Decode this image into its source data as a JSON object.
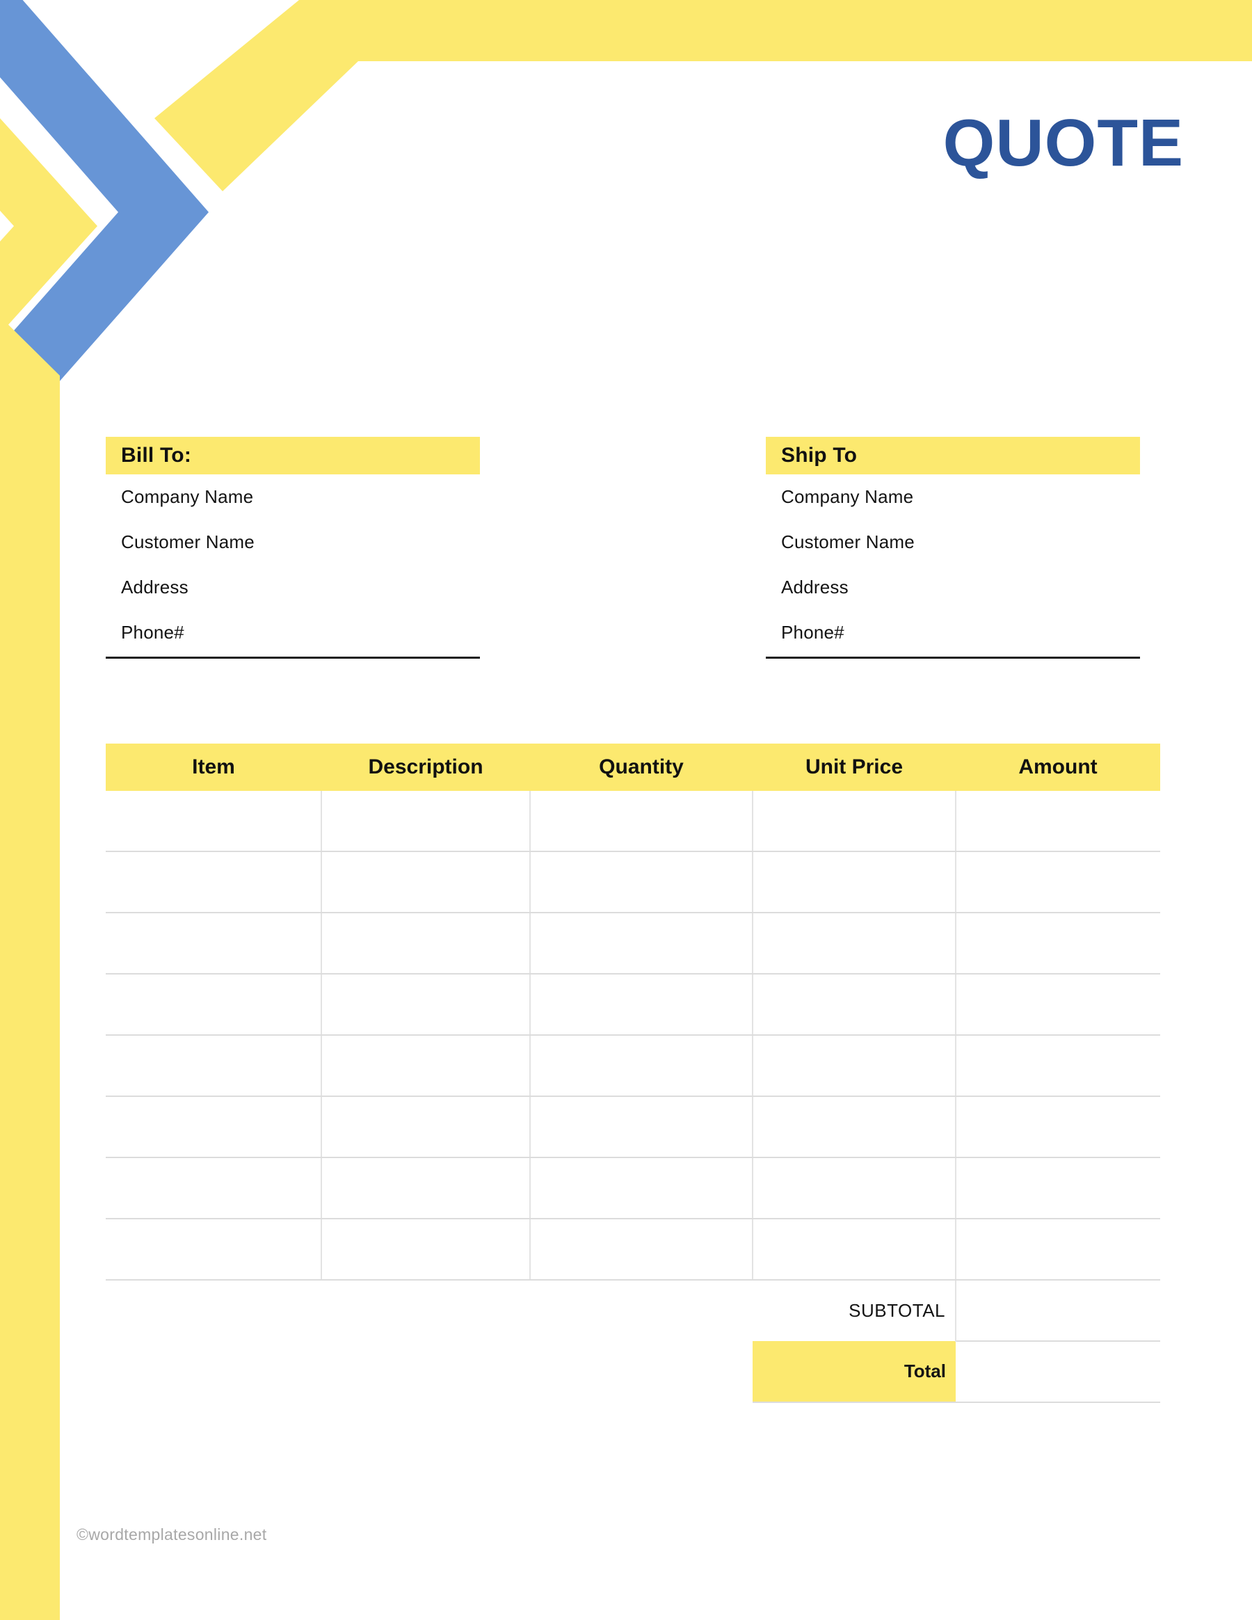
{
  "document": {
    "title": "QUOTE",
    "accent_yellow": "#fce96f",
    "accent_blue": "#6795d6",
    "title_color": "#2c5499"
  },
  "bill_to": {
    "heading": "Bill To:",
    "lines": [
      "Company Name",
      "Customer Name",
      "Address",
      "Phone#"
    ]
  },
  "ship_to": {
    "heading": "Ship To",
    "lines": [
      "Company Name",
      "Customer Name",
      "Address",
      "Phone#"
    ]
  },
  "items_table": {
    "headers": [
      "Item",
      "Description",
      "Quantity",
      "Unit Price",
      "Amount"
    ],
    "rows": [
      [
        "",
        "",
        "",
        "",
        ""
      ],
      [
        "",
        "",
        "",
        "",
        ""
      ],
      [
        "",
        "",
        "",
        "",
        ""
      ],
      [
        "",
        "",
        "",
        "",
        ""
      ],
      [
        "",
        "",
        "",
        "",
        ""
      ],
      [
        "",
        "",
        "",
        "",
        ""
      ],
      [
        "",
        "",
        "",
        "",
        ""
      ],
      [
        "",
        "",
        "",
        "",
        ""
      ]
    ],
    "subtotal_label": "SUBTOTAL",
    "subtotal_value": "",
    "total_label": "Total",
    "total_value": ""
  },
  "footer": {
    "credit": "©wordtemplatesonline.net"
  }
}
